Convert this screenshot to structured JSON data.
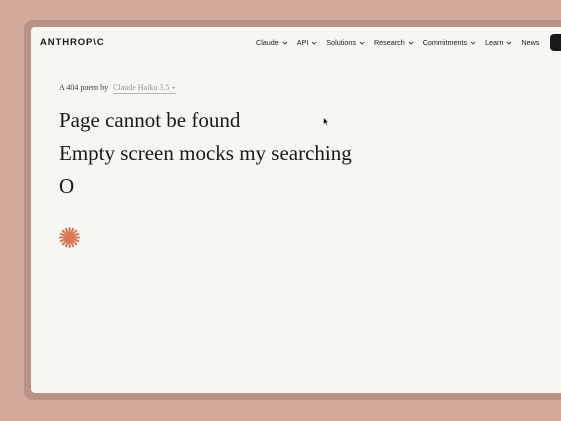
{
  "nav": {
    "logo": "ANTHROP\\C",
    "items": [
      {
        "label": "Claude",
        "dropdown": true
      },
      {
        "label": "API",
        "dropdown": true
      },
      {
        "label": "Solutions",
        "dropdown": true
      },
      {
        "label": "Research",
        "dropdown": true
      },
      {
        "label": "Commitments",
        "dropdown": true
      },
      {
        "label": "Learn",
        "dropdown": true
      },
      {
        "label": "News",
        "dropdown": false
      }
    ]
  },
  "main": {
    "subtitle_prefix": "A 404 poem by",
    "model_select": "Claude Haiku 3.5",
    "poem": [
      "Page cannot be found",
      "Empty screen mocks my searching",
      "O"
    ]
  },
  "colors": {
    "background": "#d3aa9b",
    "page": "#f7f6f2",
    "text": "#191919",
    "accent": "#d97757"
  },
  "icons": [
    "chevron-down-icon",
    "anthropic-spark-icon",
    "mouse-cursor-icon"
  ]
}
